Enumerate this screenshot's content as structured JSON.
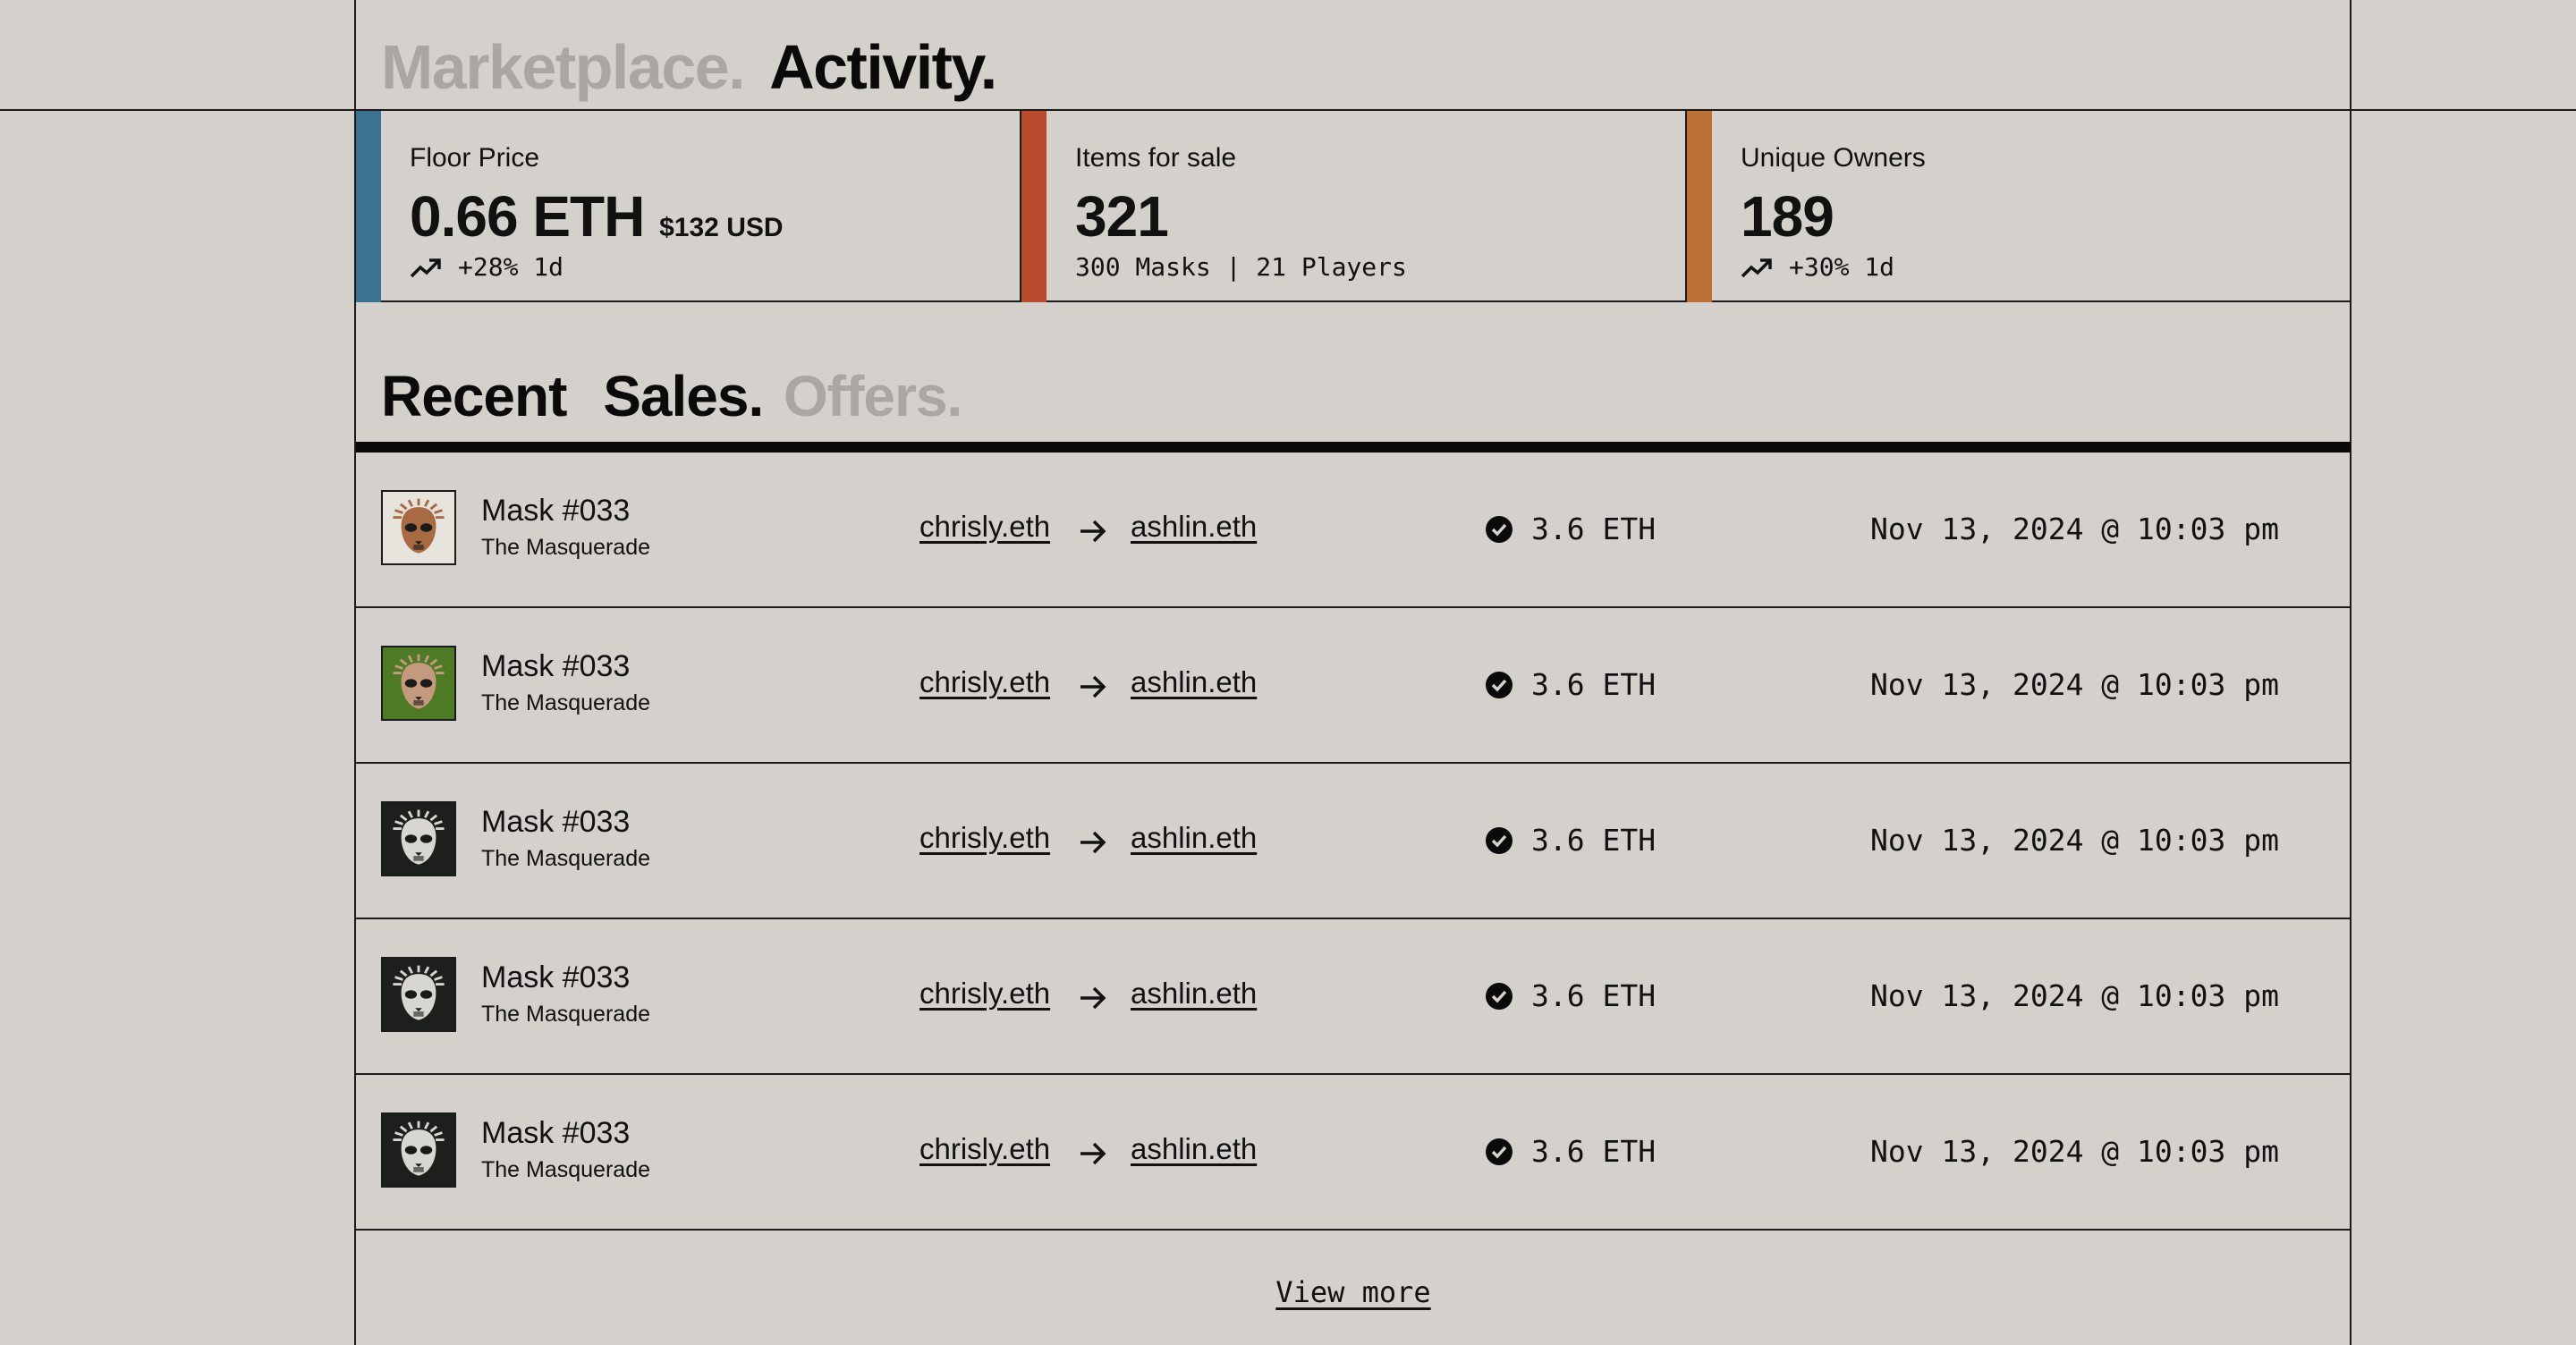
{
  "header": {
    "marketplace_label": "Marketplace.",
    "activity_label": "Activity."
  },
  "stats": [
    {
      "label": "Floor Price",
      "value": "0.66 ETH",
      "unit": "$132 USD",
      "sub": "+28% 1d",
      "accent": "#3a7290",
      "trend_icon": "trending-up-icon"
    },
    {
      "label": "Items for sale",
      "value": "321",
      "unit": "",
      "sub": "300 Masks | 21 Players",
      "accent": "#b84a2e"
    },
    {
      "label": "Unique Owners",
      "value": "189",
      "unit": "",
      "sub": "+30% 1d",
      "accent": "#bb7135",
      "trend_icon": "trending-up-icon"
    }
  ],
  "recent": {
    "title": "Recent",
    "tab_sales": "Sales.",
    "tab_offers": "Offers."
  },
  "sales": [
    {
      "item_name": "Mask #033",
      "collection": "The Masquerade",
      "from": "chrisly.eth",
      "to": "ashlin.eth",
      "price": "3.6 ETH",
      "date": "Nov 13, 2024 @ 10:03 pm",
      "thumb_bg": "#e6e2dc",
      "mask_color": "#a86a42"
    },
    {
      "item_name": "Mask #033",
      "collection": "The Masquerade",
      "from": "chrisly.eth",
      "to": "ashlin.eth",
      "price": "3.6 ETH",
      "date": "Nov 13, 2024 @ 10:03 pm",
      "thumb_bg": "#4e7a26",
      "mask_color": "#c49a7e"
    },
    {
      "item_name": "Mask #033",
      "collection": "The Masquerade",
      "from": "chrisly.eth",
      "to": "ashlin.eth",
      "price": "3.6 ETH",
      "date": "Nov 13, 2024 @ 10:03 pm",
      "thumb_bg": "#1c1f1c",
      "mask_color": "#d8d6d0"
    },
    {
      "item_name": "Mask #033",
      "collection": "The Masquerade",
      "from": "chrisly.eth",
      "to": "ashlin.eth",
      "price": "3.6 ETH",
      "date": "Nov 13, 2024 @ 10:03 pm",
      "thumb_bg": "#1c1f1c",
      "mask_color": "#d8d6d0"
    },
    {
      "item_name": "Mask #033",
      "collection": "The Masquerade",
      "from": "chrisly.eth",
      "to": "ashlin.eth",
      "price": "3.6 ETH",
      "date": "Nov 13, 2024 @ 10:03 pm",
      "thumb_bg": "#1c1f1c",
      "mask_color": "#d8d6d0"
    }
  ],
  "view_more_label": "View more"
}
